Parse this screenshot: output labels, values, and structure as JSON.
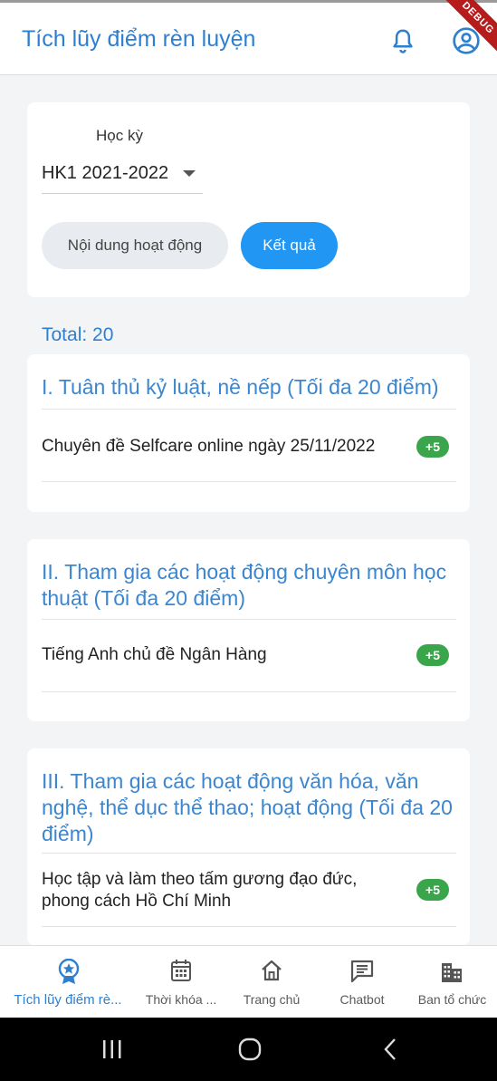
{
  "app_bar": {
    "title": "Tích lũy điểm rèn luyện",
    "icons": [
      "bell-icon",
      "account-circle-icon"
    ],
    "debug_ribbon": "DEBUG"
  },
  "filter": {
    "semester_label": "Học kỳ",
    "semester_value": "HK1 2021-2022",
    "btn_content": "Nội dung hoạt động",
    "btn_result": "Kết quả"
  },
  "total_text": "Total: 20",
  "categories": [
    {
      "title": "I. Tuân thủ kỷ luật, nề nếp (Tối đa 20 điểm)",
      "items": [
        {
          "text": "Chuyên đề Selfcare online ngày 25/11/2022",
          "points": "+5"
        }
      ]
    },
    {
      "title": "II. Tham gia các hoạt động chuyên môn học thuật (Tối đa 20 điểm)",
      "items": [
        {
          "text": "Tiếng Anh chủ đề Ngân Hàng",
          "points": "+5"
        }
      ]
    },
    {
      "title": "III. Tham gia các hoạt động văn hóa, văn nghệ, thể dục thể thao; hoạt động (Tối đa 20 điểm)",
      "items": [
        {
          "text": "Học tập và làm theo tấm gương đạo đức, phong cách Hồ Chí Minh",
          "points": "+5"
        }
      ]
    }
  ],
  "bottom_nav": [
    {
      "label": "Tích lũy điểm rè...",
      "icon": "award-icon",
      "active": true
    },
    {
      "label": "Thời khóa ...",
      "icon": "calendar-icon",
      "active": false
    },
    {
      "label": "Trang chủ",
      "icon": "home-icon",
      "active": false
    },
    {
      "label": "Chatbot",
      "icon": "chat-icon",
      "active": false
    },
    {
      "label": "Ban tổ chức",
      "icon": "building-icon",
      "active": false
    }
  ],
  "colors": {
    "primary": "#2f7fd0",
    "button_blue": "#2196f3",
    "badge_green": "#3aa54b",
    "background": "#f3f4f6"
  }
}
